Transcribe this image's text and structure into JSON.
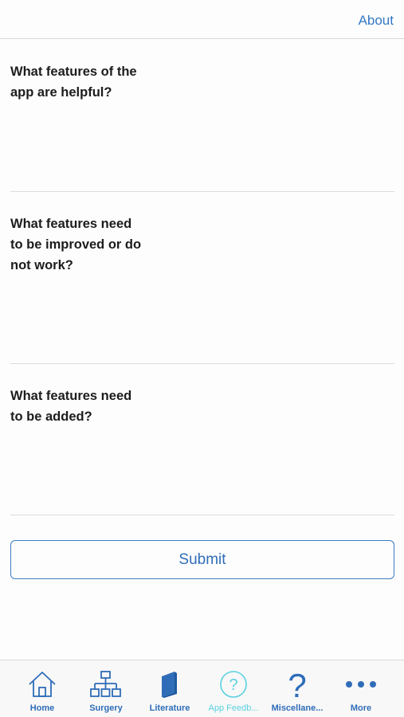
{
  "navbar": {
    "about_label": "About"
  },
  "questions": [
    {
      "label": "What features of the\napp are helpful?",
      "value": ""
    },
    {
      "label": "What features need\nto be improved or do\nnot work?",
      "value": ""
    },
    {
      "label": "What features need\nto be added?",
      "value": ""
    }
  ],
  "submit_label": "Submit",
  "tabbar": {
    "tabs": [
      {
        "label": "Home",
        "icon": "home-icon"
      },
      {
        "label": "Surgery",
        "icon": "hierarchy-icon"
      },
      {
        "label": "Literature",
        "icon": "book-icon"
      },
      {
        "label": "App Feedb...",
        "icon": "question-circle-icon",
        "active": true
      },
      {
        "label": "Miscellane...",
        "icon": "question-mark-icon"
      },
      {
        "label": "More",
        "icon": "more-dots-icon"
      }
    ]
  },
  "colors": {
    "accent": "#2f6db8",
    "active_tab": "#5ad1df",
    "divider": "#d9d9d9"
  }
}
